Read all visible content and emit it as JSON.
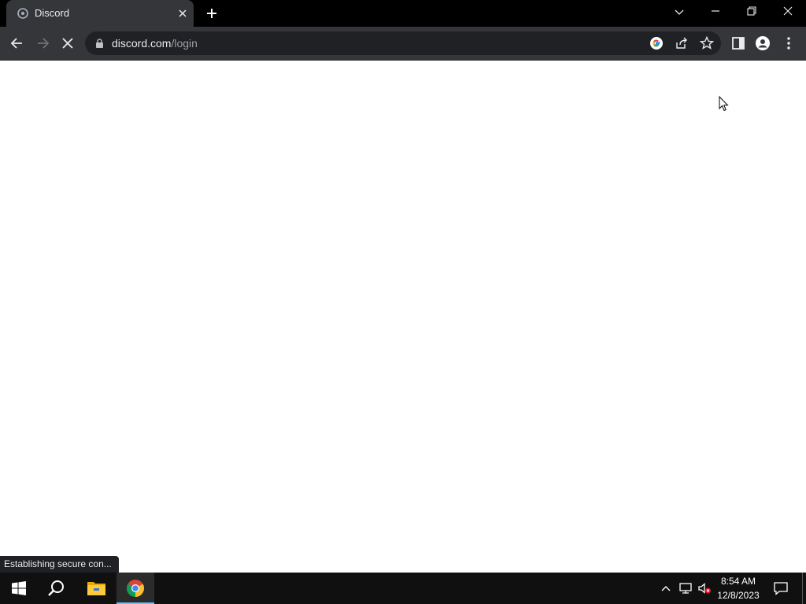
{
  "browser": {
    "tab": {
      "title": "Discord",
      "favicon": "discord-favicon"
    },
    "address": {
      "domain": "discord.com",
      "path": "/login"
    },
    "loading": true,
    "status_text": "Establishing secure con..."
  },
  "taskbar": {
    "time": "8:54 AM",
    "date": "12/8/2023",
    "pinned": [
      "start-icon",
      "search-icon",
      "file-explorer-icon",
      "chrome-icon"
    ],
    "tray": [
      "show-hidden-icons-icon",
      "network-icon",
      "volume-muted-icon",
      "notifications-icon"
    ]
  },
  "colors": {
    "titlebar": "#000000",
    "toolbar": "#35363a",
    "omnibox": "#202124",
    "taskbar": "#101010",
    "active_indicator": "#76b9ed"
  }
}
